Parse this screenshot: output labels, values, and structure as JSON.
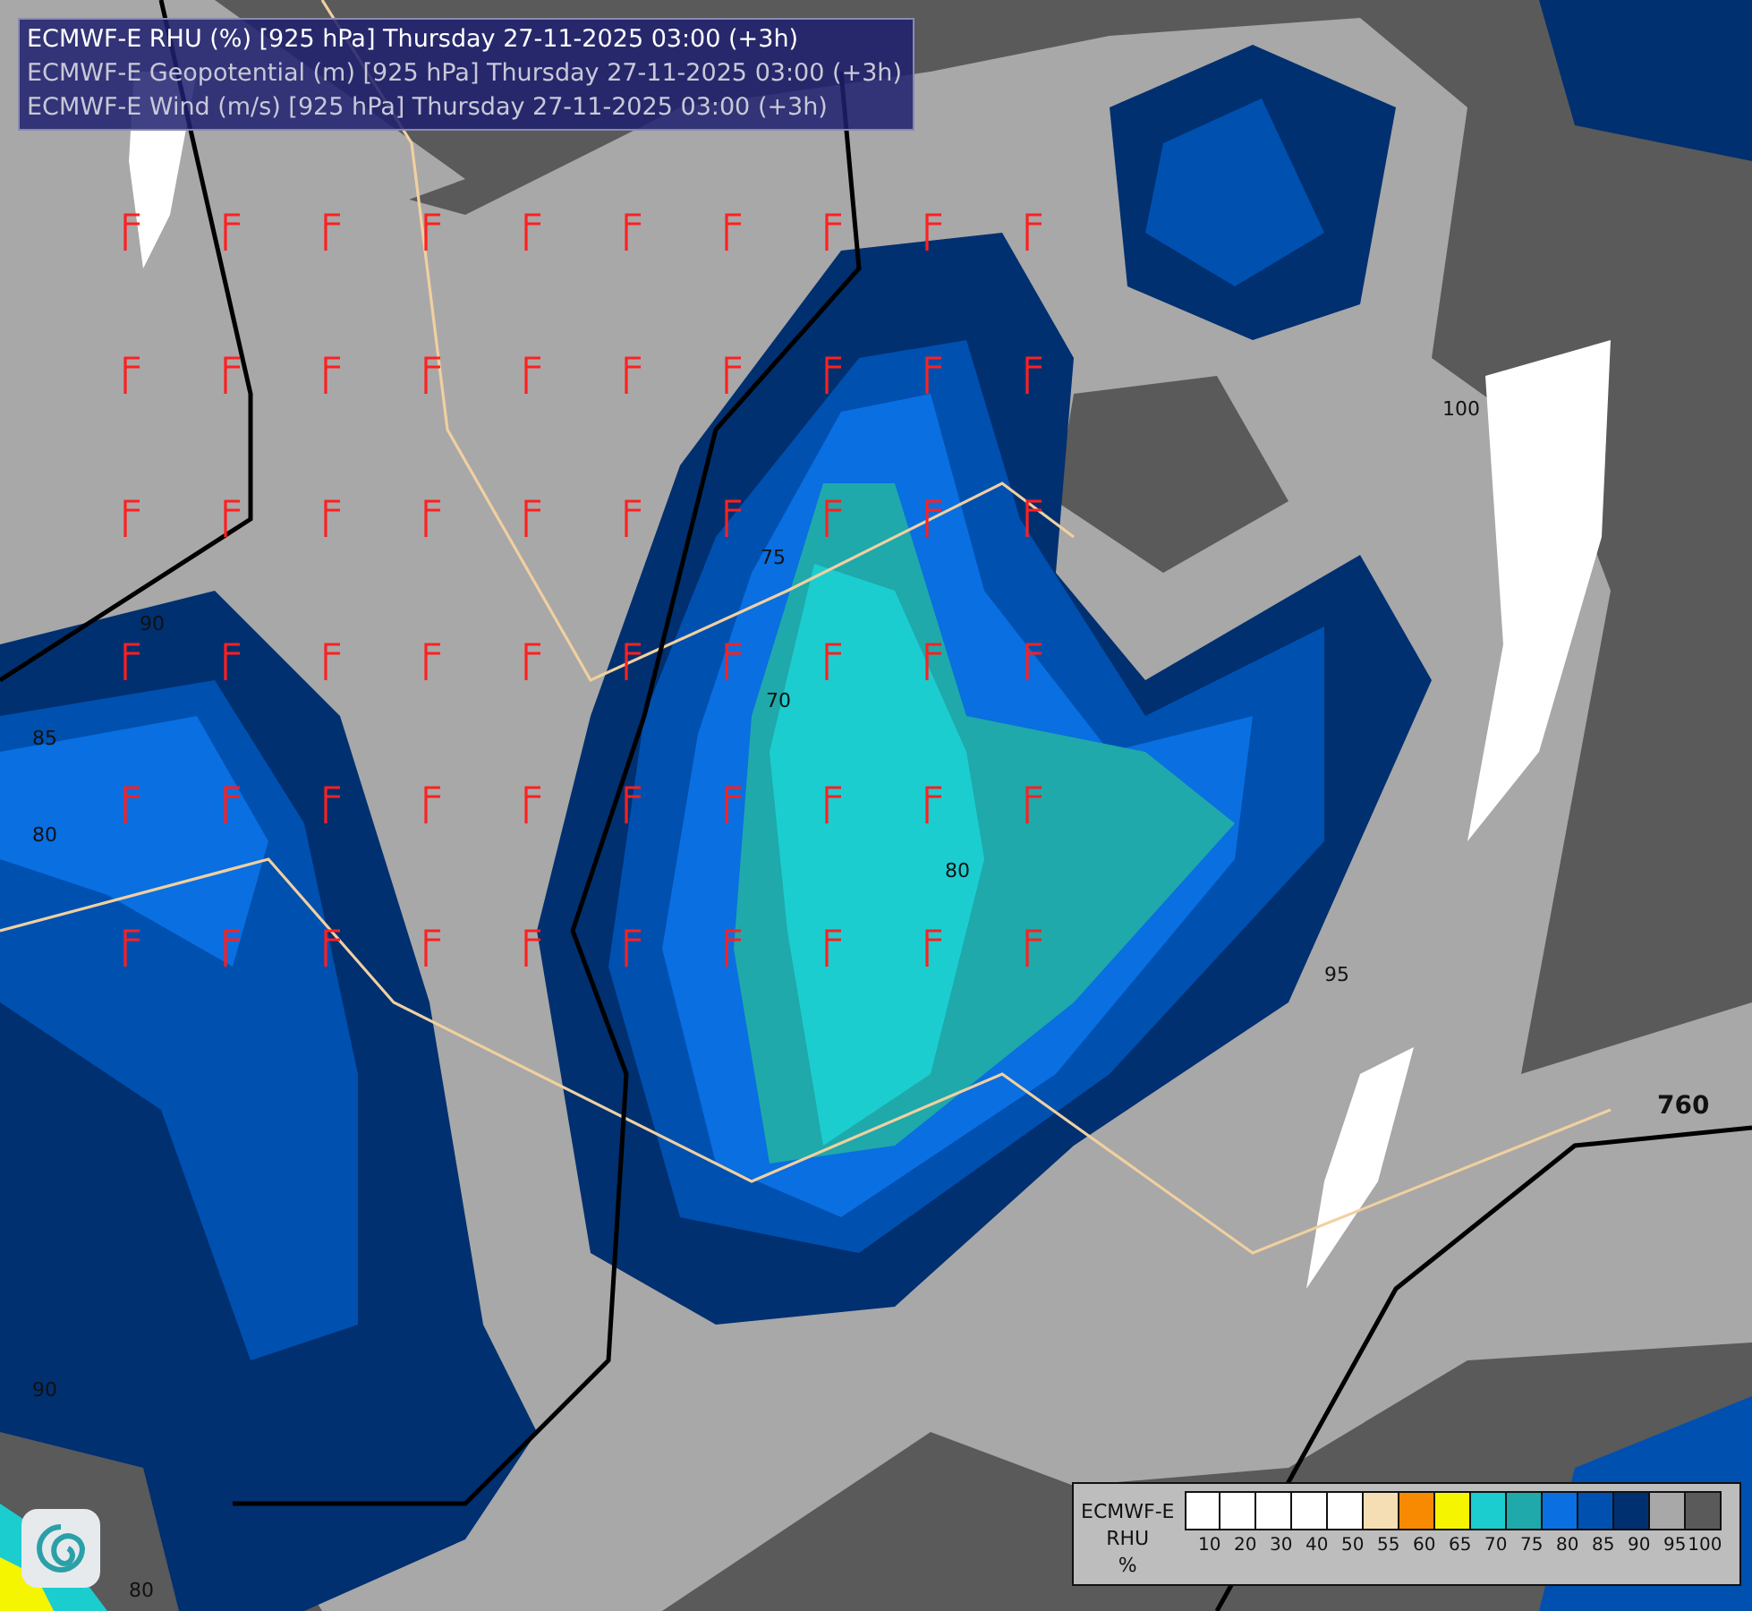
{
  "header": {
    "lines": [
      "ECMWF-E RHU (%) [925 hPa] Thursday 27-11-2025 03:00 (+3h)",
      "ECMWF-E Geopotential (m) [925 hPa] Thursday 27-11-2025 03:00 (+3h)",
      "ECMWF-E Wind (m/s) [925 hPa] Thursday 27-11-2025 03:00 (+3h)"
    ]
  },
  "map": {
    "contour_labels": [
      "760",
      "100",
      "95",
      "90",
      "80",
      "75",
      "70",
      "85",
      "80",
      "90",
      "80"
    ]
  },
  "legend": {
    "title_lines": [
      "ECMWF-E",
      "RHU",
      "%"
    ],
    "bins": [
      {
        "color": "#ffffff",
        "label": "10"
      },
      {
        "color": "#ffffff",
        "label": "20"
      },
      {
        "color": "#ffffff",
        "label": "30"
      },
      {
        "color": "#ffffff",
        "label": "40"
      },
      {
        "color": "#ffffff",
        "label": "50"
      },
      {
        "color": "#f5deb3",
        "label": "55"
      },
      {
        "color": "#f78a00",
        "label": "60"
      },
      {
        "color": "#f5f500",
        "label": "65"
      },
      {
        "color": "#1ccdd0",
        "label": "70"
      },
      {
        "color": "#1fa9aa",
        "label": "75"
      },
      {
        "color": "#0a6fe0",
        "label": "80"
      },
      {
        "color": "#0050b0",
        "label": "85"
      },
      {
        "color": "#003070",
        "label": "90"
      },
      {
        "color": "#a8a8a8",
        "label": "95"
      },
      {
        "color": "#5a5a5a",
        "label": "100"
      }
    ]
  }
}
